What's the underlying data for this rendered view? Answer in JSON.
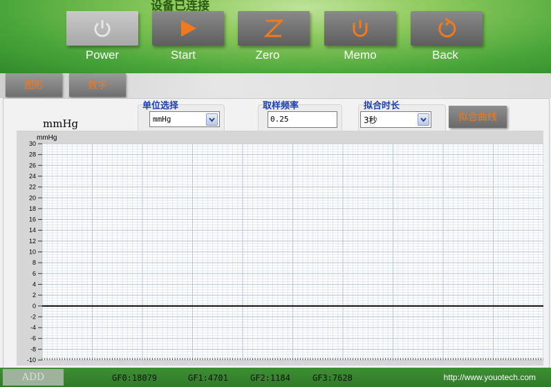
{
  "header": {
    "status_text": "设备已连接",
    "buttons": [
      {
        "label": "Power",
        "icon": "power-icon"
      },
      {
        "label": "Start",
        "icon": "play-icon"
      },
      {
        "label": "Zero",
        "icon": "zero-icon"
      },
      {
        "label": "Memo",
        "icon": "memo-icon"
      },
      {
        "label": "Back",
        "icon": "back-icon"
      }
    ]
  },
  "tabs": [
    {
      "label": "图形"
    },
    {
      "label": "数字"
    }
  ],
  "controls": {
    "unit_display": "mmHg",
    "unit_select": {
      "label": "单位选择",
      "value": "mmHg"
    },
    "sample_rate": {
      "label": "取样频率",
      "value": "0.25"
    },
    "fit_duration": {
      "label": "拟合时长",
      "value": "3秒"
    },
    "fit_button": "拟合曲线"
  },
  "chart_data": {
    "type": "line",
    "ylabel": "mmHg",
    "ylim": [
      -10,
      30
    ],
    "y_ticks": [
      30,
      28,
      26,
      24,
      22,
      20,
      18,
      16,
      14,
      12,
      10,
      8,
      6,
      4,
      2,
      0,
      -2,
      -4,
      -6,
      -8,
      -10
    ],
    "grid": true,
    "series": [
      {
        "values": [
          0,
          0
        ]
      }
    ]
  },
  "footer": {
    "add_button": "ADD",
    "gf0": "GF0:18079",
    "gf1": "GF1:4701",
    "gf2": "GF2:1184",
    "gf3": "GF3:7628",
    "url": "http://www.youotech.com"
  },
  "colors": {
    "accent_orange": "#f27a1e",
    "header_green": "#4aa63a",
    "label_blue": "#1c3fb0"
  }
}
